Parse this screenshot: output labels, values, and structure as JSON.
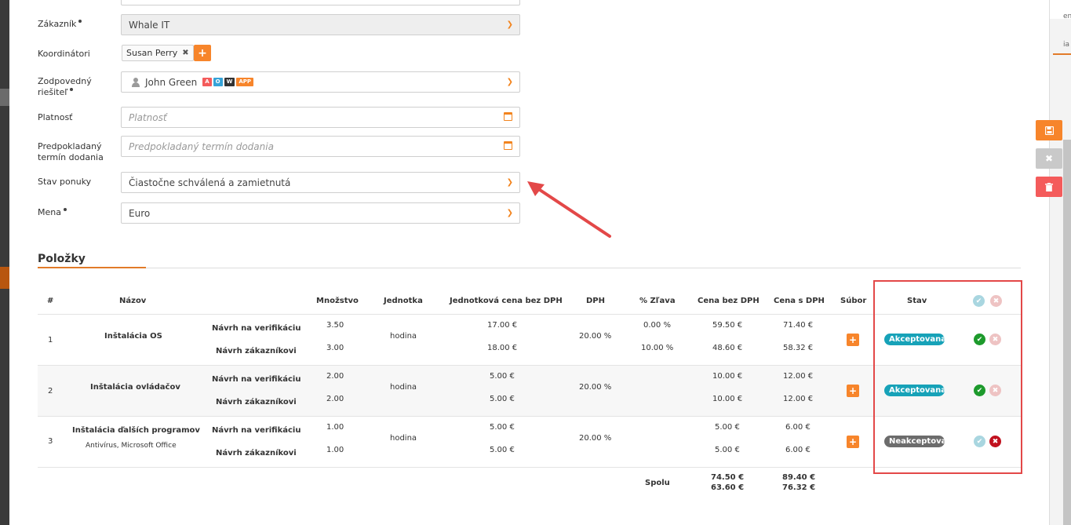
{
  "form": {
    "customer": {
      "label": "Zákazník",
      "value": "Whale IT"
    },
    "coordinators": {
      "label": "Koordinátori",
      "tag": "Susan Perry",
      "tag_remove": "✖",
      "add": "+"
    },
    "responsible": {
      "label_line1": "Zodpovedný",
      "label_line2": "riešiteľ",
      "value": "John Green",
      "badges": [
        "A",
        "O",
        "W",
        "APP"
      ]
    },
    "validity": {
      "label": "Platnosť",
      "placeholder": "Platnosť"
    },
    "delivery": {
      "label_line1": "Predpokladaný",
      "label_line2": "termín dodania",
      "placeholder": "Predpokladaný termín dodania"
    },
    "offer_state": {
      "label": "Stav ponuky",
      "value": "Čiastočne schválená a zamietnutá"
    },
    "currency": {
      "label": "Mena",
      "value": "Euro"
    }
  },
  "items": {
    "section_title": "Položky",
    "headers": {
      "num": "#",
      "name": "Názov",
      "qty": "Množstvo",
      "unit": "Jednotka",
      "unit_price": "Jednotková cena bez DPH",
      "vat": "DPH",
      "discount": "% Zľava",
      "price_no_vat": "Cena bez DPH",
      "price_vat": "Cena s DPH",
      "file": "Súbor",
      "status": "Stav"
    },
    "rows": [
      {
        "num": "1",
        "name": "Inštalácia OS",
        "sub": "",
        "variant_a": "Návrh na verifikáciu",
        "variant_b": "Návrh zákazníkovi",
        "qty_a": "3.50",
        "qty_b": "3.00",
        "unit": "hodina",
        "price_a": "17.00 €",
        "price_b": "18.00 €",
        "vat": "20.00 %",
        "disc_a": "0.00 %",
        "disc_b": "10.00 %",
        "net_a": "59.50 €",
        "net_b": "48.60 €",
        "gross_a": "71.40 €",
        "gross_b": "58.32 €",
        "status": "Akceptovaná"
      },
      {
        "num": "2",
        "name": "Inštalácia ovládačov",
        "sub": "",
        "variant_a": "Návrh na verifikáciu",
        "variant_b": "Návrh zákazníkovi",
        "qty_a": "2.00",
        "qty_b": "2.00",
        "unit": "hodina",
        "price_a": "5.00 €",
        "price_b": "5.00 €",
        "vat": "20.00 %",
        "disc_a": "",
        "disc_b": "",
        "net_a": "10.00 €",
        "net_b": "10.00 €",
        "gross_a": "12.00 €",
        "gross_b": "12.00 €",
        "status": "Akceptovaná"
      },
      {
        "num": "3",
        "name": "Inštalácia ďalších programov",
        "sub": "Antivírus, Microsoft Office",
        "variant_a": "Návrh na verifikáciu",
        "variant_b": "Návrh zákazníkovi",
        "qty_a": "1.00",
        "qty_b": "1.00",
        "unit": "hodina",
        "price_a": "5.00 €",
        "price_b": "5.00 €",
        "vat": "20.00 %",
        "disc_a": "",
        "disc_b": "",
        "net_a": "5.00 €",
        "net_b": "5.00 €",
        "gross_a": "6.00 €",
        "gross_b": "6.00 €",
        "status": "Neakceptovaná"
      }
    ],
    "totals": {
      "label": "Spolu",
      "net_a": "74.50 €",
      "net_b": "63.60 €",
      "gross_a": "89.40 €",
      "gross_b": "76.32 €"
    }
  },
  "side_panel": {
    "text_top": "en",
    "text_mid": "ia"
  },
  "icons": {
    "save": "floppy-icon",
    "cancel": "close-icon",
    "delete": "trash-icon",
    "add": "plus-icon",
    "check": "check-circle-icon",
    "reject": "x-circle-icon",
    "calendar": "calendar-icon",
    "user": "user-icon"
  },
  "colors": {
    "accent": "#f7852b",
    "accepted": "#17a2b8",
    "rejected": "#6c6c6c",
    "danger": "#f45b5b",
    "annotation": "#e34848"
  }
}
